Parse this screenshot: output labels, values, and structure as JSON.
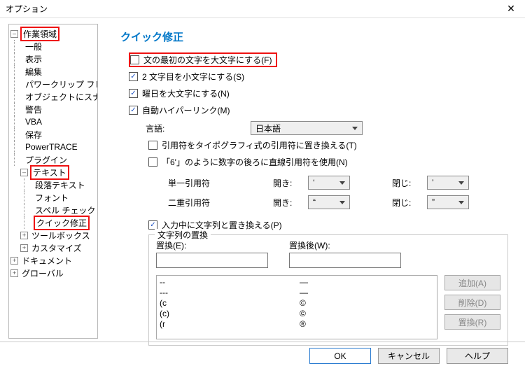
{
  "window": {
    "title": "オプション"
  },
  "tree": {
    "work_area": "作業領域",
    "general": "一般",
    "display": "表示",
    "edit": "編集",
    "powerclip": "パワークリップ フレーム",
    "snap": "オブジェクトにスナップ",
    "warning": "警告",
    "vba": "VBA",
    "save": "保存",
    "powertrace": "PowerTRACE",
    "plugin": "プラグイン",
    "text": "テキスト",
    "paragraph": "段落テキスト",
    "font": "フォント",
    "spell": "スペル チェック",
    "quickfix": "クイック修正",
    "toolbox": "ツールボックス",
    "customize": "カスタマイズ",
    "document": "ドキュメント",
    "global": "グローバル"
  },
  "panel": {
    "heading": "クイック修正",
    "cap_first": "文の最初の文字を大文字にする(F)",
    "lower2nd": "2 文字目を小文字にする(S)",
    "cap_day": "曜日を大文字にする(N)",
    "autohyper": "自動ハイパーリンク(M)",
    "lang_label": "言語:",
    "lang_value": "日本語",
    "typo_quote": "引用符をタイポグラフィ式の引用符に置き換える(T)",
    "straight_after_num": "「6'」のように数字の後ろに直線引用符を使用(N)",
    "single_quote": "単一引用符",
    "double_quote": "二重引用符",
    "open_l": "開き:",
    "close_l": "閉じ:",
    "sq_open": "‘",
    "sq_close": "’",
    "dq_open": "“",
    "dq_close": "”",
    "replace_typing": "入力中に文字列と置き換える(P)",
    "group_title": "文字列の置換",
    "replace_l": "置換(E):",
    "after_l": "置換後(W):",
    "list": [
      [
        "--",
        "—"
      ],
      [
        "---",
        "—"
      ],
      [
        "(c",
        "©"
      ],
      [
        "(c)",
        "©"
      ],
      [
        "(r",
        "®"
      ]
    ],
    "btn_add": "追加(A)",
    "btn_del": "削除(D)",
    "btn_rep": "置換(R)"
  },
  "buttons": {
    "ok": "OK",
    "cancel": "キャンセル",
    "help": "ヘルプ"
  }
}
